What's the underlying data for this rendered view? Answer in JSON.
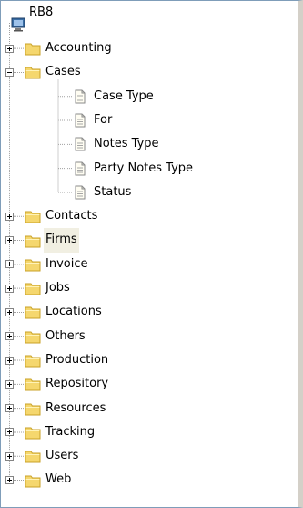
{
  "tree": {
    "root": {
      "label": "RB8",
      "icon": "computer-icon"
    },
    "items": [
      {
        "label": "Accounting",
        "icon": "folder-icon",
        "expanded": false
      },
      {
        "label": "Cases",
        "icon": "folder-icon",
        "expanded": true,
        "children": [
          {
            "label": "Case Type",
            "icon": "document-icon"
          },
          {
            "label": "For",
            "icon": "document-icon"
          },
          {
            "label": "Notes Type",
            "icon": "document-icon"
          },
          {
            "label": "Party Notes Type",
            "icon": "document-icon"
          },
          {
            "label": "Status",
            "icon": "document-icon"
          }
        ]
      },
      {
        "label": "Contacts",
        "icon": "folder-icon",
        "expanded": false
      },
      {
        "label": "Firms",
        "icon": "folder-icon",
        "expanded": false,
        "hovered": true
      },
      {
        "label": "Invoice",
        "icon": "folder-icon",
        "expanded": false
      },
      {
        "label": "Jobs",
        "icon": "folder-icon",
        "expanded": false
      },
      {
        "label": "Locations",
        "icon": "folder-icon",
        "expanded": false
      },
      {
        "label": "Others",
        "icon": "folder-icon",
        "expanded": false
      },
      {
        "label": "Production",
        "icon": "folder-icon",
        "expanded": false
      },
      {
        "label": "Repository",
        "icon": "folder-icon",
        "expanded": false
      },
      {
        "label": "Resources",
        "icon": "folder-icon",
        "expanded": false
      },
      {
        "label": "Tracking",
        "icon": "folder-icon",
        "expanded": false
      },
      {
        "label": "Users",
        "icon": "folder-icon",
        "expanded": false
      },
      {
        "label": "Web",
        "icon": "folder-icon",
        "expanded": false
      }
    ]
  },
  "colors": {
    "folder": "#f5d76e",
    "folder_edge": "#c9a227",
    "tree_line": "#a0a0a0",
    "hover_bg": "#f1efe2"
  }
}
